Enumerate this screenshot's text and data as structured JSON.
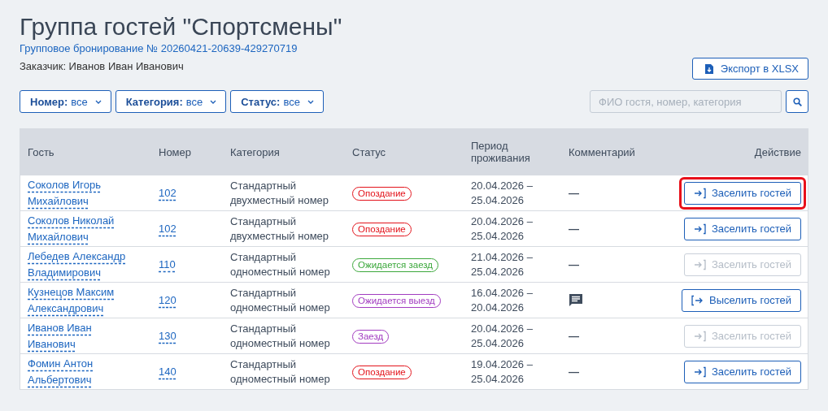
{
  "title": "Группа гостей \"Спортсмены\"",
  "booking_link": "Групповое бронирование № 20260421-20639-429270719",
  "customer": "Заказчик: Иванов Иван Иванович",
  "export_button": "Экспорт в XLSX",
  "filters": [
    {
      "label": "Номер:",
      "value": "все"
    },
    {
      "label": "Категория:",
      "value": "все"
    },
    {
      "label": "Статус:",
      "value": "все"
    }
  ],
  "search": {
    "placeholder": "ФИО гостя, номер, категория"
  },
  "table": {
    "columns": [
      "Гость",
      "Номер",
      "Категория",
      "Статус",
      "Период проживания",
      "Комментарий",
      "Действие"
    ],
    "rows": [
      {
        "guest": "Соколов Игорь Михайлович",
        "room": "102",
        "category": "Стандартный двухместный номер",
        "status": {
          "text": "Опоздание",
          "color": "#e3131b"
        },
        "period": "20.04.2026 – 25.04.2026",
        "comment": {
          "kind": "dash",
          "text": "—"
        },
        "action": {
          "kind": "checkin",
          "text": "Заселить гостей",
          "disabled": false,
          "highlighted": true
        }
      },
      {
        "guest": "Соколов Николай Михайлович",
        "room": "102",
        "category": "Стандартный двухместный номер",
        "status": {
          "text": "Опоздание",
          "color": "#e3131b"
        },
        "period": "20.04.2026 – 25.04.2026",
        "comment": {
          "kind": "dash",
          "text": "—"
        },
        "action": {
          "kind": "checkin",
          "text": "Заселить гостей",
          "disabled": false,
          "highlighted": false
        }
      },
      {
        "guest": "Лебедев Александр Владимирович",
        "room": "110",
        "category": "Стандартный одноместный номер",
        "status": {
          "text": "Ожидается заезд",
          "color": "#3ca83c"
        },
        "period": "21.04.2026 – 25.04.2026",
        "comment": {
          "kind": "dash",
          "text": "—"
        },
        "action": {
          "kind": "checkin",
          "text": "Заселить гостей",
          "disabled": true,
          "highlighted": false
        }
      },
      {
        "guest": "Кузнецов Максим Александрович",
        "room": "120",
        "category": "Стандартный одноместный номер",
        "status": {
          "text": "Ожидается выезд",
          "color": "#a23cc0"
        },
        "period": "16.04.2026 – 20.04.2026",
        "comment": {
          "kind": "note"
        },
        "action": {
          "kind": "checkout",
          "text": "Выселить гостей",
          "disabled": false,
          "highlighted": false
        }
      },
      {
        "guest": "Иванов Иван Иванович",
        "room": "130",
        "category": "Стандартный одноместный номер",
        "status": {
          "text": "Заезд",
          "color": "#a23cc0"
        },
        "period": "20.04.2026 – 25.04.2026",
        "comment": {
          "kind": "dash",
          "text": "—"
        },
        "action": {
          "kind": "checkin",
          "text": "Заселить гостей",
          "disabled": true,
          "highlighted": false
        }
      },
      {
        "guest": "Фомин Антон Альбертович",
        "room": "140",
        "category": "Стандартный одноместный номер",
        "status": {
          "text": "Опоздание",
          "color": "#e3131b"
        },
        "period": "19.04.2026 – 25.04.2026",
        "comment": {
          "kind": "dash",
          "text": "—"
        },
        "action": {
          "kind": "checkin",
          "text": "Заселить гостей",
          "disabled": false,
          "highlighted": false
        }
      }
    ]
  }
}
